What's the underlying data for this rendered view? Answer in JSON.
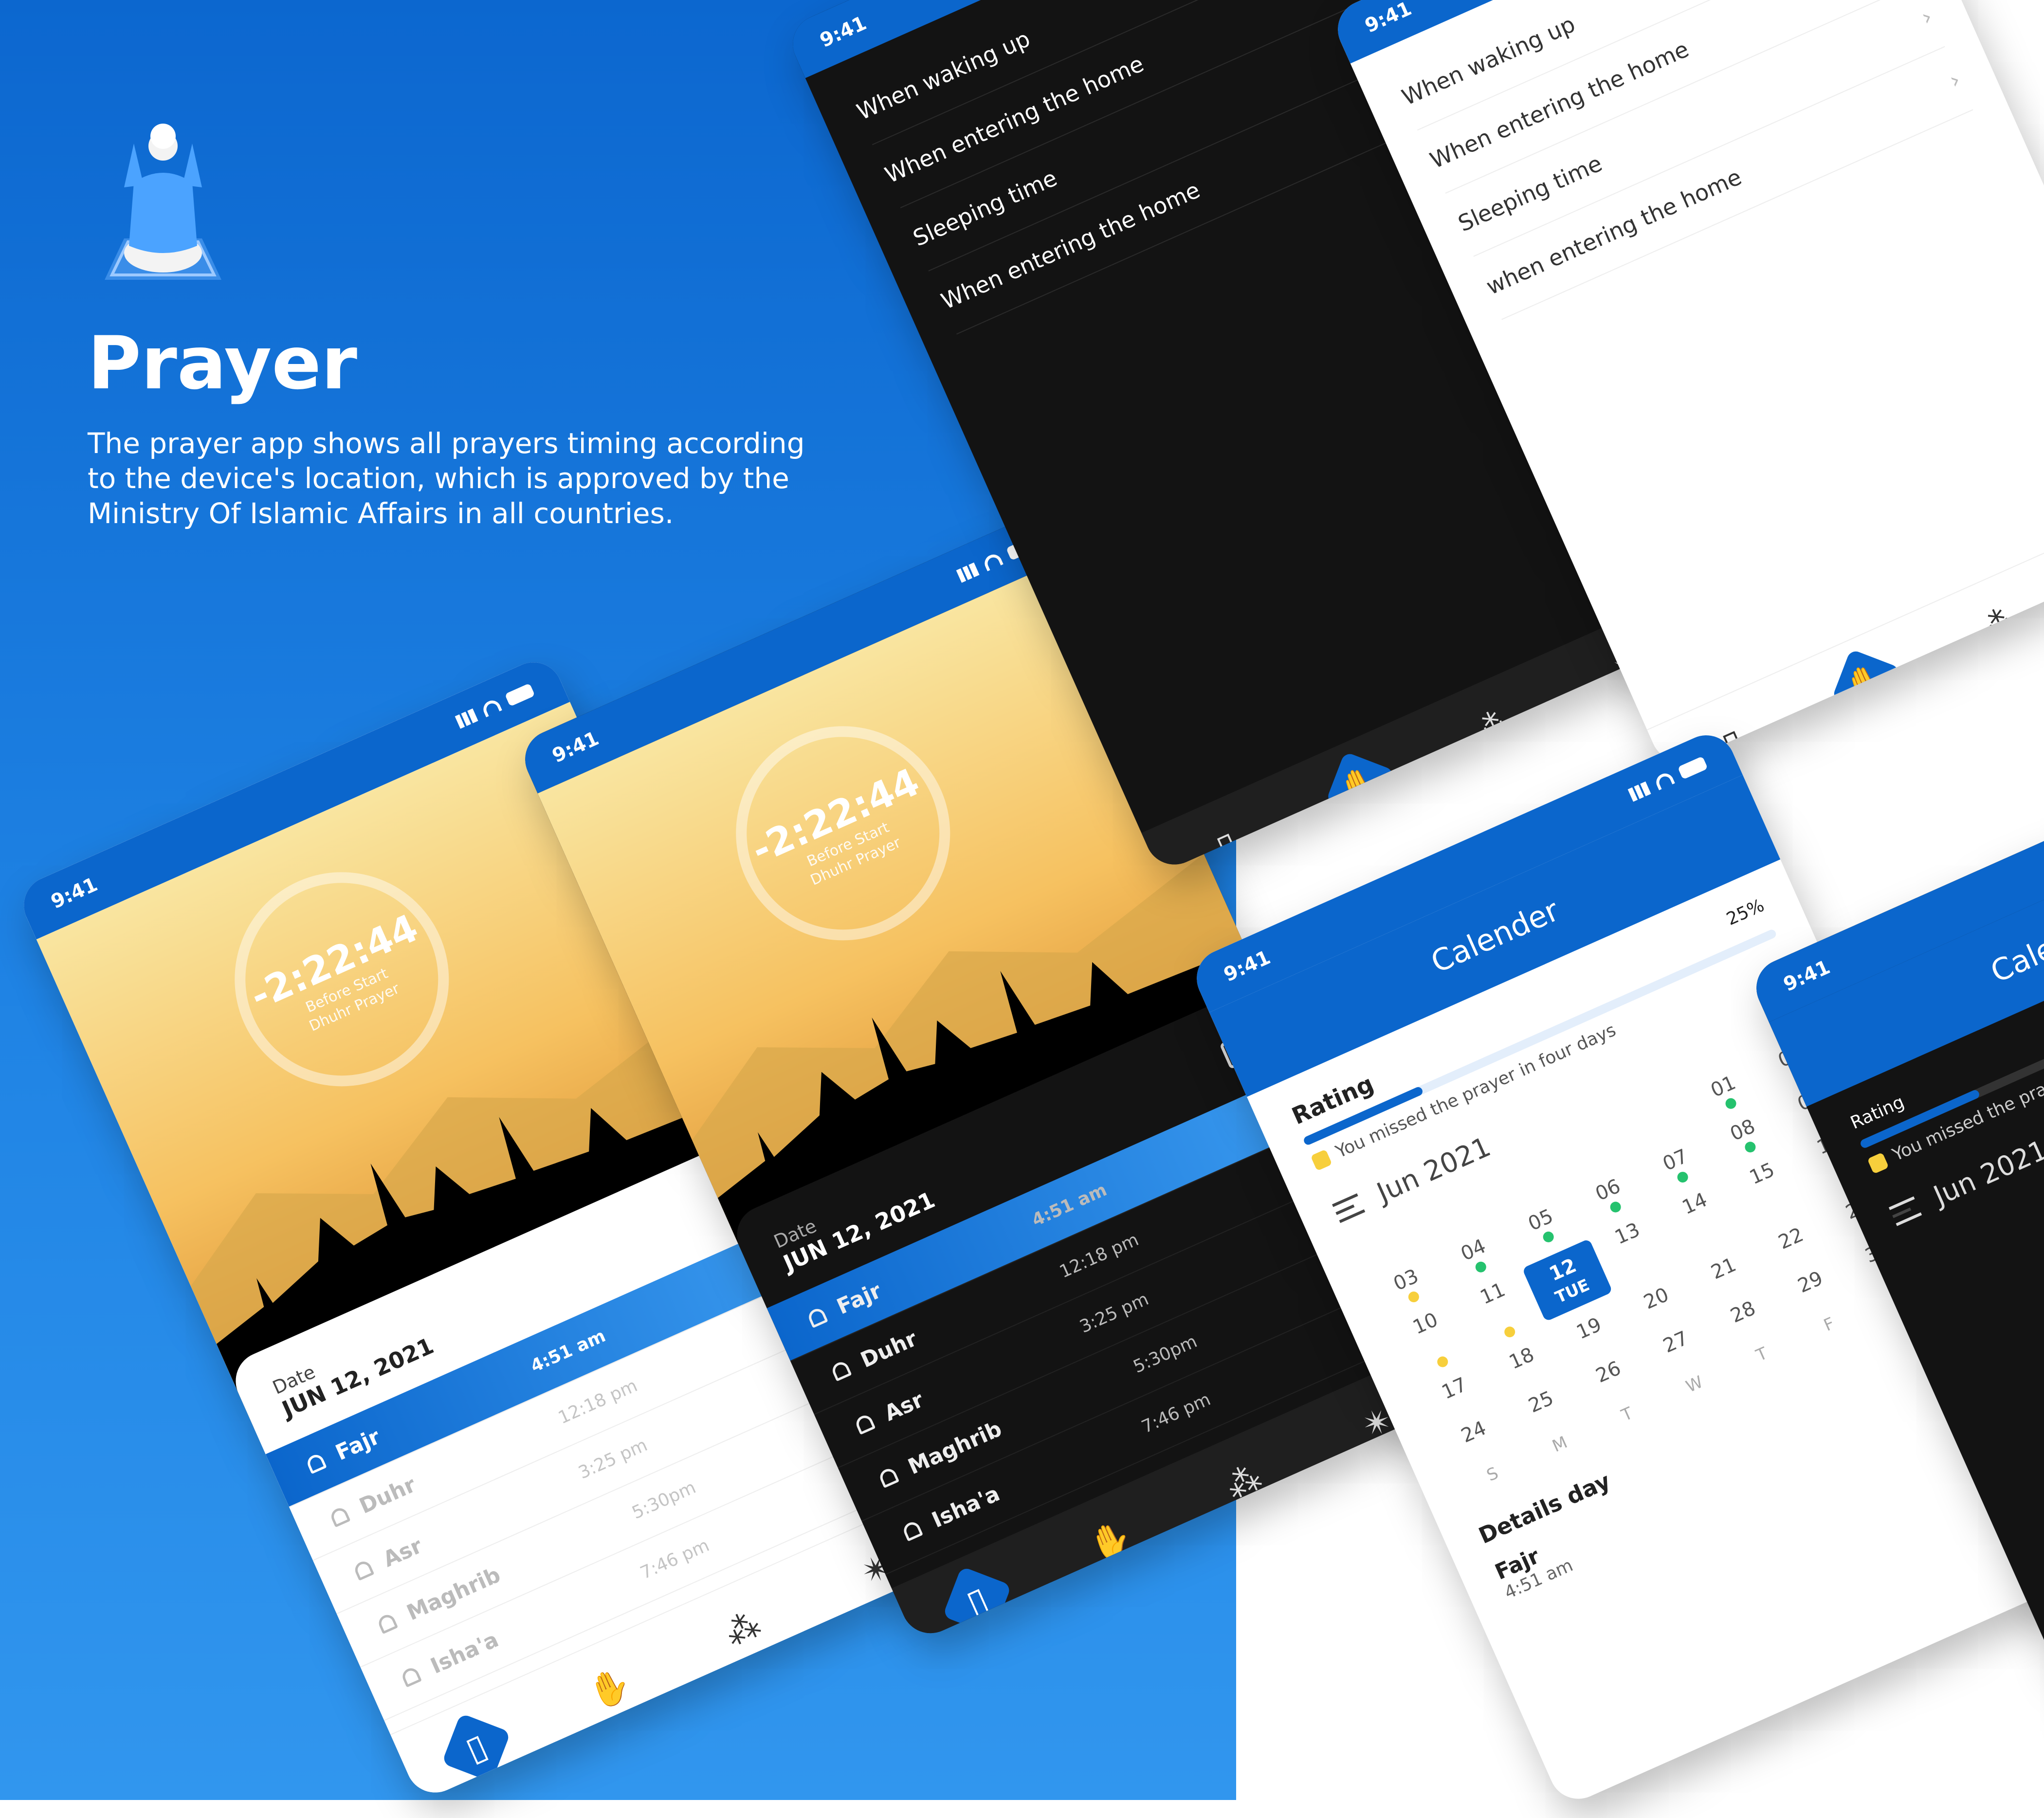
{
  "hero": {
    "title": "Prayer",
    "description": "The prayer app shows all prayers timing according to the device's location, which is approved by the Ministry Of Islamic Affairs in all countries."
  },
  "colors": {
    "brand_blue": "#0b66cc",
    "sky_top": "#f9e5a0",
    "sky_bottom": "#d88a2b",
    "accent_yellow": "#f7cf3c",
    "done_green": "#25c26e"
  },
  "status_bar": {
    "time": "9:41"
  },
  "countdown": {
    "time": "-2:22:44",
    "caption_line1": "Before Start",
    "caption_line2": "Dhuhr Prayer"
  },
  "date_card": {
    "label": "Date",
    "value": "JUN 12, 2021"
  },
  "prayers": [
    {
      "name": "Fajr",
      "time": "4:51 am",
      "active": true
    },
    {
      "name": "Duhr",
      "time": "12:18 pm",
      "active": false
    },
    {
      "name": "Asr",
      "time": "3:25 pm",
      "active": false
    },
    {
      "name": "Maghrib",
      "time": "5:30pm",
      "active": false
    },
    {
      "name": "Isha'a",
      "time": "7:46 pm",
      "active": false
    }
  ],
  "nav_icons": [
    "prayer-mat-icon",
    "praying-hands-icon",
    "prayer-beads-icon",
    "octagram-icon"
  ],
  "adhkar_menu": {
    "items": [
      "When waking up",
      "When entering the home",
      "Sleeping time",
      "when entering the home"
    ],
    "dark_items": [
      "When waking up",
      "When entering the home",
      "Sleeping time",
      "When entering the home"
    ]
  },
  "calendar": {
    "title": "Calender",
    "rating_label": "Rating",
    "rating_percent": "25%",
    "missed_text": "You missed the prayer in four days",
    "month": "Jun 2021",
    "weekdays": [
      "S",
      "M",
      "T",
      "W",
      "T",
      "F",
      "S"
    ],
    "selected_day": "12",
    "selected_weekday": "TUE",
    "details_label": "Details day",
    "details_prayer": "Fajr",
    "details_time": "4:51 am"
  }
}
